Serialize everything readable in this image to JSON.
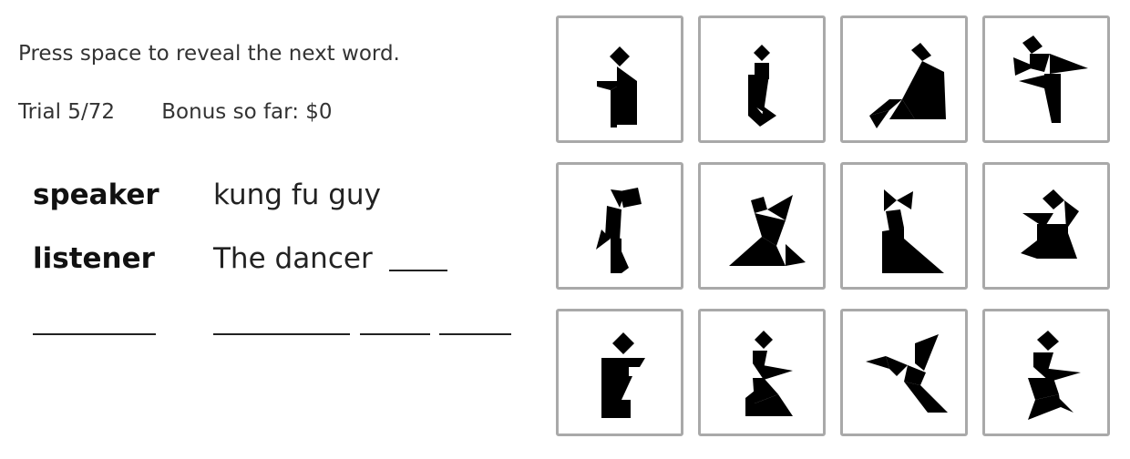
{
  "instructions": "Press space to reveal the next word.",
  "trial": "Trial 5/72",
  "bonus": "Bonus so far: $0",
  "dialog": {
    "speaker_label": "speaker",
    "speaker_text": "kung fu guy",
    "listener_label": "listener",
    "listener_text": "The dancer"
  },
  "tangram_grid": {
    "rows": 3,
    "columns": 4,
    "tiles": [
      {
        "icon": "tangram-figure-1-icon"
      },
      {
        "icon": "tangram-figure-2-icon"
      },
      {
        "icon": "tangram-figure-3-icon"
      },
      {
        "icon": "tangram-figure-4-icon"
      },
      {
        "icon": "tangram-figure-5-icon"
      },
      {
        "icon": "tangram-figure-6-icon"
      },
      {
        "icon": "tangram-figure-7-icon"
      },
      {
        "icon": "tangram-figure-8-icon"
      },
      {
        "icon": "tangram-figure-9-icon"
      },
      {
        "icon": "tangram-figure-10-icon"
      },
      {
        "icon": "tangram-figure-11-icon"
      },
      {
        "icon": "tangram-figure-12-icon"
      }
    ]
  },
  "colors": {
    "tile_border": "#a9a9a9",
    "figure": "#000000",
    "text": "#222222"
  }
}
